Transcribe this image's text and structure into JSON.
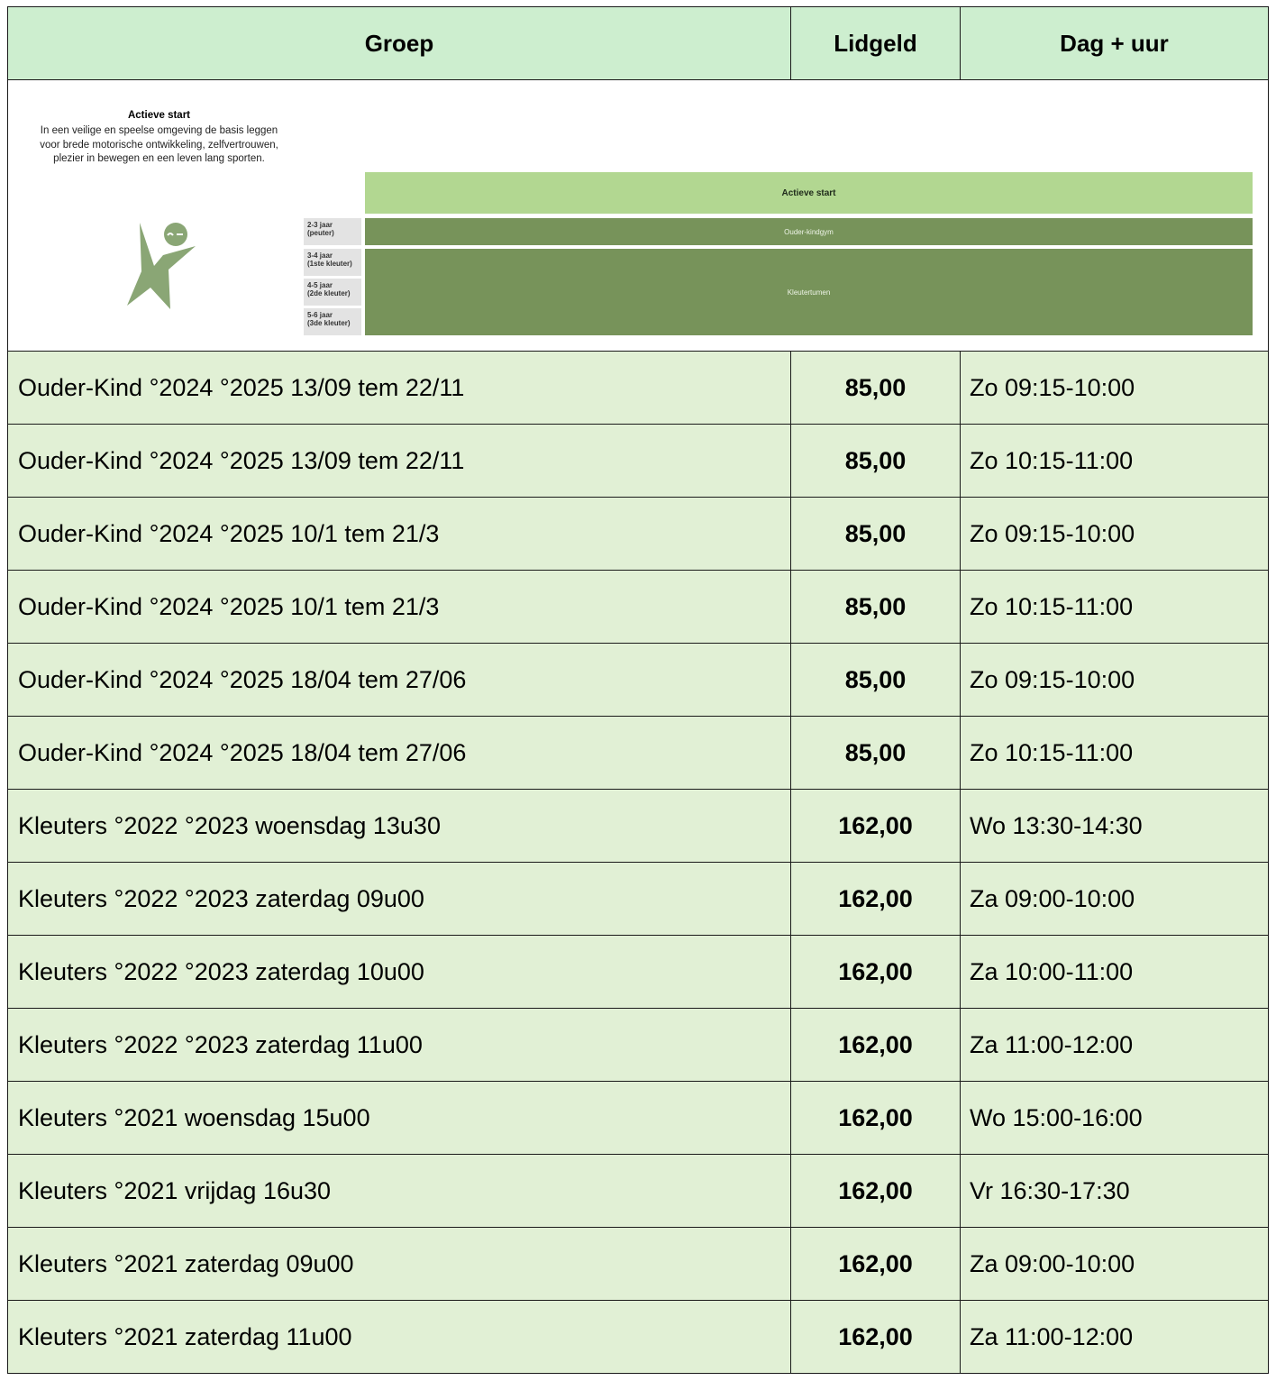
{
  "headers": {
    "groep": "Groep",
    "lidgeld": "Lidgeld",
    "dag_uur": "Dag + uur"
  },
  "banner": {
    "title": "Actieve start",
    "description": "In een veilige en speelse omgeving de basis leggen voor brede motorische ontwikkeling, zelfvertrouwen, plezier in bewegen en een leven lang sporten.",
    "logo_icon": "running-figure-icon",
    "ages": [
      {
        "line1": "2-3 jaar",
        "line2": "(peuter)"
      },
      {
        "line1": "3-4 jaar",
        "line2": "(1ste kleuter)"
      },
      {
        "line1": "4-5 jaar",
        "line2": "(2de kleuter)"
      },
      {
        "line1": "5-6 jaar",
        "line2": "(3de kleuter)"
      }
    ],
    "bar_top": "Actieve start",
    "bar_mid": "Ouder-kindgym",
    "bar_big": "Kleutertumen"
  },
  "rows": [
    {
      "groep": "Ouder-Kind °2024 °2025 13/09 tem 22/11",
      "lidgeld": "85,00",
      "dag_uur": "Zo 09:15-10:00"
    },
    {
      "groep": "Ouder-Kind °2024 °2025 13/09 tem 22/11",
      "lidgeld": "85,00",
      "dag_uur": "Zo 10:15-11:00"
    },
    {
      "groep": "Ouder-Kind °2024 °2025 10/1 tem 21/3",
      "lidgeld": "85,00",
      "dag_uur": "Zo 09:15-10:00"
    },
    {
      "groep": "Ouder-Kind °2024 °2025 10/1 tem 21/3",
      "lidgeld": "85,00",
      "dag_uur": "Zo 10:15-11:00"
    },
    {
      "groep": "Ouder-Kind °2024 °2025 18/04 tem 27/06",
      "lidgeld": "85,00",
      "dag_uur": "Zo 09:15-10:00"
    },
    {
      "groep": "Ouder-Kind °2024 °2025 18/04 tem 27/06",
      "lidgeld": "85,00",
      "dag_uur": "Zo 10:15-11:00"
    },
    {
      "groep": "Kleuters °2022 °2023 woensdag 13u30",
      "lidgeld": "162,00",
      "dag_uur": "Wo 13:30-14:30"
    },
    {
      "groep": "Kleuters °2022 °2023 zaterdag 09u00",
      "lidgeld": "162,00",
      "dag_uur": "Za 09:00-10:00"
    },
    {
      "groep": "Kleuters °2022 °2023 zaterdag 10u00",
      "lidgeld": "162,00",
      "dag_uur": "Za 10:00-11:00"
    },
    {
      "groep": "Kleuters °2022 °2023 zaterdag 11u00",
      "lidgeld": "162,00",
      "dag_uur": "Za 11:00-12:00"
    },
    {
      "groep": "Kleuters °2021 woensdag 15u00",
      "lidgeld": "162,00",
      "dag_uur": "Wo 15:00-16:00"
    },
    {
      "groep": "Kleuters °2021 vrijdag 16u30",
      "lidgeld": "162,00",
      "dag_uur": "Vr 16:30-17:30"
    },
    {
      "groep": "Kleuters °2021 zaterdag 09u00",
      "lidgeld": "162,00",
      "dag_uur": "Za 09:00-10:00"
    },
    {
      "groep": "Kleuters °2021 zaterdag 11u00",
      "lidgeld": "162,00",
      "dag_uur": "Za 11:00-12:00"
    }
  ],
  "colors": {
    "header_bg": "#cdeecf",
    "row_bg": "#e1f0d5",
    "bar_light": "#b2d791",
    "bar_dark": "#77935a",
    "logo": "#8aa675"
  }
}
